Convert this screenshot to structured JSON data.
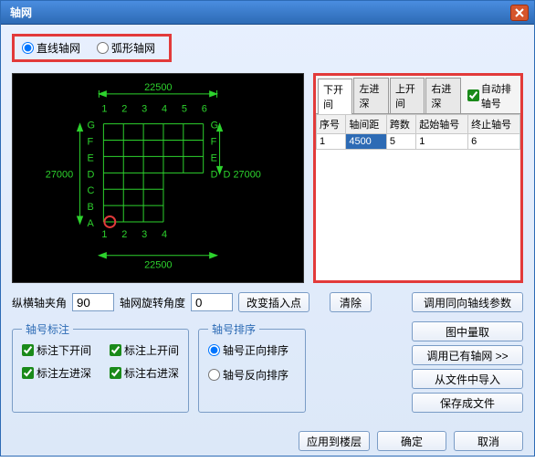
{
  "window": {
    "title": "轴网"
  },
  "radios": {
    "straight": "直线轴网",
    "arc": "弧形轴网",
    "selected": "straight"
  },
  "tabs": {
    "items": [
      "下开间",
      "左进深",
      "上开间",
      "右进深"
    ],
    "active": 0,
    "auto_label": "自动排轴号"
  },
  "table": {
    "headers": [
      "序号",
      "轴间距",
      "跨数",
      "起始轴号",
      "终止轴号"
    ],
    "rows": [
      {
        "seq": "1",
        "dist": "4500",
        "span": "5",
        "start": "1",
        "end": "6"
      }
    ]
  },
  "angle": {
    "cross_label": "纵横轴夹角",
    "cross_val": "90",
    "rot_label": "轴网旋转角度",
    "rot_val": "0",
    "change_btn": "改变插入点"
  },
  "clear_btn": "清除",
  "right_buttons": {
    "b1": "调用同向轴线参数",
    "b2": "图中量取",
    "b3": "调用已有轴网  >>",
    "b4": "从文件中导入",
    "b5": "保存成文件"
  },
  "mark_group": {
    "legend": "轴号标注",
    "c1": "标注下开间",
    "c2": "标注上开间",
    "c3": "标注左进深",
    "c4": "标注右进深"
  },
  "sort_group": {
    "legend": "轴号排序",
    "r1": "轴号正向排序",
    "r2": "轴号反向排序"
  },
  "bottom": {
    "apply": "应用到楼层",
    "ok": "确定",
    "cancel": "取消"
  },
  "preview": {
    "dim_top": "22500",
    "dim_bot": "22500",
    "dim_left": "27000",
    "dim_right": "D  27000",
    "cols_top": [
      "1",
      "2",
      "3",
      "4",
      "5",
      "6"
    ],
    "cols_bot": [
      "1",
      "2",
      "3",
      "4"
    ],
    "rows_left": [
      "G",
      "F",
      "E",
      "D",
      "C",
      "B",
      "A"
    ],
    "rows_right": [
      "G",
      "F",
      "E",
      "D"
    ]
  }
}
